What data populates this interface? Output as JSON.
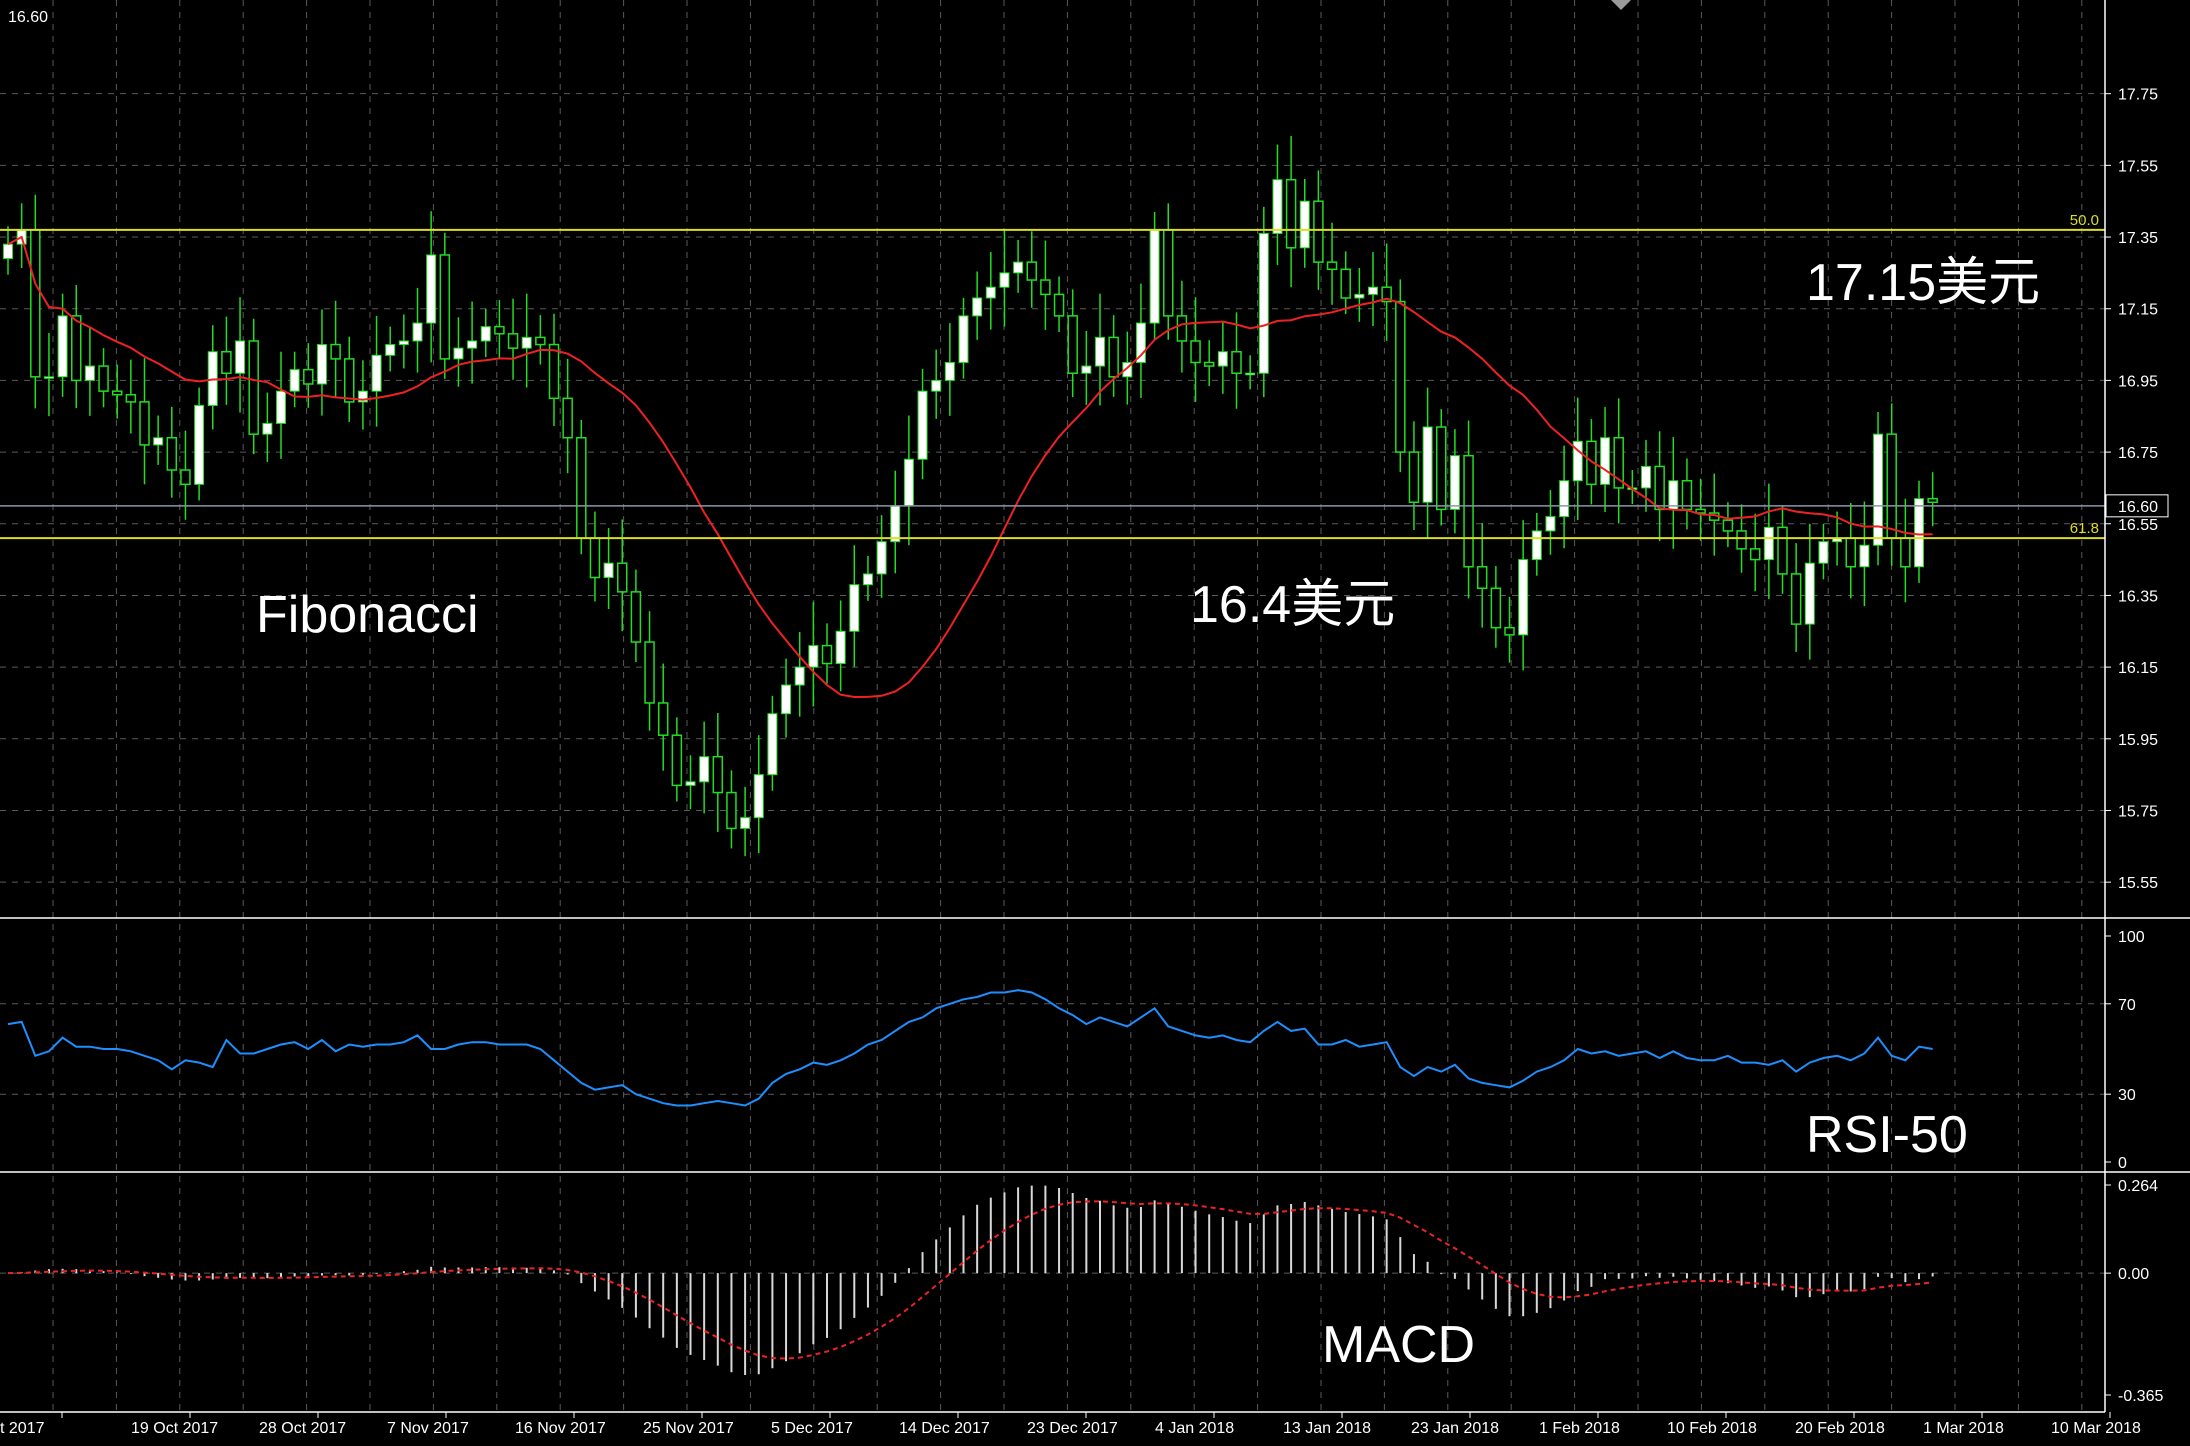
{
  "colors": {
    "background": "#000000",
    "grid": "#5a5a5a",
    "axis": "#ffffff",
    "bull_body": "#ffffff",
    "bull_wick": "#22dd22",
    "bear_body": "#000000",
    "bear_outline": "#22dd22",
    "moving_average": "#ee2222",
    "fib_line": "#dddd22",
    "price_line": "#8a96aa",
    "rsi_line": "#1e8fff",
    "macd_hist": "#d8d8d8",
    "macd_signal": "#ee2222"
  },
  "header": {
    "symbol_price": "16.60"
  },
  "chart_data": [
    {
      "type": "candlestick",
      "title": "",
      "grid": true,
      "ylim": [
        15.45,
        17.95
      ],
      "yticks": [
        15.55,
        15.75,
        15.95,
        16.15,
        16.35,
        16.55,
        16.75,
        16.95,
        17.15,
        17.35,
        17.55,
        17.75
      ],
      "ytick_labels": [
        "15.55",
        "15.75",
        "15.95",
        "16.15",
        "16.35",
        "16.55",
        "16.75",
        "16.95",
        "17.15",
        "17.35",
        "17.55",
        "17.75"
      ],
      "x_labels": [
        "t 2017",
        "19 Oct 2017",
        "28 Oct 2017",
        "7 Nov 2017",
        "16 Nov 2017",
        "25 Nov 2017",
        "5 Dec 2017",
        "14 Dec 2017",
        "23 Dec 2017",
        "4 Jan 2018",
        "13 Jan 2018",
        "23 Jan 2018",
        "1 Feb 2018",
        "10 Feb 2018",
        "20 Feb 2018",
        "1 Mar 2018",
        "10 Mar 2018"
      ],
      "closes": [
        17.33,
        17.37,
        16.96,
        16.96,
        17.13,
        16.95,
        16.99,
        16.92,
        16.91,
        16.89,
        16.77,
        16.79,
        16.7,
        16.66,
        16.88,
        17.03,
        16.97,
        17.06,
        16.8,
        16.83,
        16.92,
        16.98,
        16.94,
        17.05,
        17.01,
        16.89,
        16.92,
        17.02,
        17.05,
        17.06,
        17.11,
        17.3,
        17.01,
        17.04,
        17.06,
        17.1,
        17.08,
        17.04,
        17.07,
        17.05,
        16.9,
        16.79,
        16.51,
        16.4,
        16.44,
        16.36,
        16.22,
        16.05,
        15.96,
        15.82,
        15.83,
        15.9,
        15.8,
        15.7,
        15.73,
        15.85,
        16.02,
        16.1,
        16.15,
        16.21,
        16.16,
        16.25,
        16.38,
        16.41,
        16.5,
        16.6,
        16.73,
        16.92,
        16.95,
        17.0,
        17.13,
        17.18,
        17.21,
        17.25,
        17.28,
        17.23,
        17.19,
        17.13,
        16.97,
        16.99,
        17.07,
        16.96,
        17.0,
        17.11,
        17.37,
        17.13,
        17.06,
        17.0,
        16.99,
        17.03,
        16.97,
        16.97,
        17.36,
        17.51,
        17.32,
        17.45,
        17.28,
        17.26,
        17.18,
        17.19,
        17.21,
        17.17,
        16.75,
        16.61,
        16.82,
        16.59,
        16.74,
        16.43,
        16.37,
        16.26,
        16.24,
        16.45,
        16.53,
        16.57,
        16.67,
        16.78,
        16.66,
        16.79,
        16.65,
        16.65,
        16.71,
        16.59,
        16.67,
        16.59,
        16.58,
        16.56,
        16.53,
        16.48,
        16.45,
        16.54,
        16.41,
        16.27,
        16.44,
        16.5,
        16.51,
        16.43,
        16.49,
        16.8,
        16.51,
        16.43,
        16.62,
        16.61
      ],
      "ma_period": 20,
      "fib_levels": [
        {
          "label": "50.0",
          "value": 17.37
        },
        {
          "label": "61.8",
          "value": 16.51
        }
      ],
      "current_price": 16.6,
      "current_price_label": "16.60",
      "annotations": [
        {
          "text": "17.15美元"
        },
        {
          "text": "16.4美元"
        },
        {
          "text": "Fibonacci"
        }
      ]
    },
    {
      "type": "line",
      "title": "RSI-50",
      "grid": true,
      "ylim": [
        0,
        100
      ],
      "yticks": [
        0,
        30,
        70,
        100
      ],
      "ytick_labels": [
        "0",
        "30",
        "70",
        "100"
      ],
      "series": [
        {
          "values": [
            61,
            62,
            47,
            49,
            55,
            51,
            51,
            50,
            50,
            49,
            47,
            45,
            41,
            45,
            44,
            42,
            54,
            48,
            48,
            50,
            52,
            53,
            50,
            54,
            49,
            52,
            51,
            52,
            52,
            53,
            56,
            50,
            50,
            52,
            53,
            53,
            52,
            52,
            52,
            50,
            45,
            40,
            35,
            32,
            33,
            34,
            30,
            28,
            26,
            25,
            25,
            26,
            27,
            26,
            25,
            28,
            35,
            39,
            41,
            44,
            43,
            45,
            48,
            52,
            54,
            58,
            62,
            64,
            68,
            70,
            72,
            73,
            75,
            75,
            76,
            75,
            72,
            68,
            65,
            61,
            64,
            62,
            60,
            64,
            68,
            60,
            58,
            56,
            55,
            56,
            54,
            53,
            58,
            62,
            58,
            59,
            52,
            52,
            54,
            51,
            52,
            53,
            42,
            38,
            42,
            40,
            43,
            37,
            35,
            34,
            33,
            36,
            40,
            42,
            45,
            50,
            48,
            49,
            47,
            48,
            49,
            46,
            49,
            46,
            45,
            45,
            47,
            44,
            44,
            43,
            45,
            40,
            44,
            46,
            47,
            45,
            48,
            55,
            47,
            45,
            51,
            50
          ]
        }
      ]
    },
    {
      "type": "bar",
      "title": "MACD",
      "grid": true,
      "ylim": [
        -0.365,
        0.264
      ],
      "yticks": [
        -0.365,
        0.0,
        0.264
      ],
      "ytick_labels": [
        "-0.365",
        "0.00",
        "0.264"
      ],
      "series": [
        {
          "name": "",
          "values": [
            0.0,
            0.003,
            0.008,
            0.012,
            0.013,
            0.012,
            0.01,
            0.006,
            0.002,
            -0.003,
            -0.009,
            -0.014,
            -0.019,
            -0.022,
            -0.022,
            -0.019,
            -0.017,
            -0.014,
            -0.016,
            -0.015,
            -0.013,
            -0.01,
            -0.009,
            -0.007,
            -0.006,
            -0.007,
            -0.005,
            -0.002,
            0.002,
            0.006,
            0.01,
            0.019,
            0.017,
            0.017,
            0.017,
            0.018,
            0.018,
            0.017,
            0.016,
            0.016,
            0.008,
            -0.004,
            -0.03,
            -0.055,
            -0.079,
            -0.104,
            -0.133,
            -0.165,
            -0.193,
            -0.224,
            -0.245,
            -0.26,
            -0.277,
            -0.297,
            -0.305,
            -0.303,
            -0.285,
            -0.264,
            -0.24,
            -0.213,
            -0.194,
            -0.168,
            -0.134,
            -0.103,
            -0.068,
            -0.029,
            0.015,
            0.063,
            0.101,
            0.137,
            0.173,
            0.205,
            0.226,
            0.242,
            0.257,
            0.262,
            0.262,
            0.255,
            0.24,
            0.225,
            0.217,
            0.203,
            0.196,
            0.198,
            0.218,
            0.208,
            0.199,
            0.187,
            0.176,
            0.168,
            0.157,
            0.15,
            0.176,
            0.203,
            0.207,
            0.213,
            0.203,
            0.193,
            0.183,
            0.177,
            0.17,
            0.161,
            0.108,
            0.057,
            0.034,
            -0.003,
            -0.017,
            -0.049,
            -0.079,
            -0.107,
            -0.129,
            -0.129,
            -0.119,
            -0.105,
            -0.082,
            -0.054,
            -0.041,
            -0.018,
            -0.017,
            -0.016,
            -0.009,
            -0.014,
            -0.011,
            -0.016,
            -0.02,
            -0.024,
            -0.03,
            -0.037,
            -0.044,
            -0.04,
            -0.052,
            -0.072,
            -0.072,
            -0.063,
            -0.053,
            -0.055,
            -0.048,
            -0.011,
            -0.015,
            -0.027,
            -0.018,
            -0.01
          ]
        }
      ],
      "signal_ema": 9
    }
  ]
}
